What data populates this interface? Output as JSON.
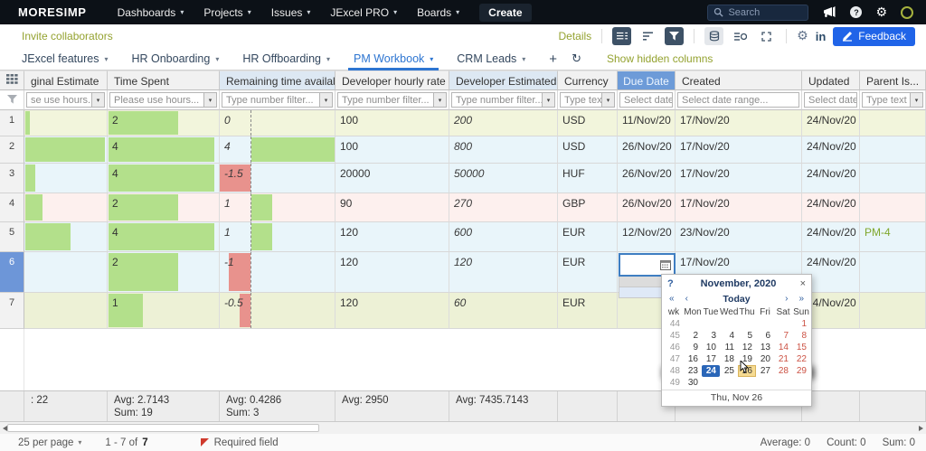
{
  "navbar": {
    "logo": "MORESIMP",
    "menus": [
      "Dashboards",
      "Projects",
      "Issues",
      "JExcel PRO",
      "Boards"
    ],
    "create_label": "Create",
    "search_placeholder": "Search"
  },
  "toolbar": {
    "invite_label": "Invite collaborators",
    "details_label": "Details",
    "linkedin_label": "in",
    "feedback_label": "Feedback",
    "feedback_color": "#2064e8",
    "active_button_color": "#3d5166"
  },
  "tabs": {
    "items": [
      {
        "label": "JExcel features",
        "active": false
      },
      {
        "label": "HR Onboarding",
        "active": false
      },
      {
        "label": "HR Offboarding",
        "active": false
      },
      {
        "label": "PM Workbook",
        "active": true
      },
      {
        "label": "CRM Leads",
        "active": false
      }
    ],
    "active_color": "#2d75d1",
    "show_hidden_label": "Show hidden columns"
  },
  "grid": {
    "columns": [
      {
        "key": "corner",
        "label": "",
        "width": 27,
        "ftype": "corner"
      },
      {
        "key": "oe",
        "label": "ginal Estimate",
        "width": 92,
        "hl": false,
        "selected": false,
        "filter": "se use hours...",
        "ftype": "select"
      },
      {
        "key": "ts",
        "label": "Time Spent",
        "width": 124,
        "hl": false,
        "selected": false,
        "filter": "Please use hours...",
        "ftype": "select"
      },
      {
        "key": "rta",
        "label": "Remaining time available",
        "width": 128,
        "hl": true,
        "selected": false,
        "filter": "Type number filter...",
        "ftype": "select"
      },
      {
        "key": "dhr",
        "label": "Developer hourly rate",
        "width": 126,
        "hl": false,
        "selected": false,
        "filter": "Type number filter...",
        "ftype": "select"
      },
      {
        "key": "de",
        "label": "Developer Estimated ...",
        "width": 120,
        "hl": true,
        "selected": false,
        "filter": "Type number filter...",
        "ftype": "select"
      },
      {
        "key": "cur",
        "label": "Currency",
        "width": 66,
        "hl": false,
        "selected": false,
        "filter": "Type text f",
        "ftype": "select"
      },
      {
        "key": "due",
        "label": "Due Date",
        "width": 64,
        "hl": false,
        "selected": true,
        "filter": "Select date",
        "ftype": "date"
      },
      {
        "key": "created",
        "label": "Created",
        "width": 140,
        "hl": false,
        "selected": false,
        "filter": "Select date range...",
        "ftype": "date"
      },
      {
        "key": "updated",
        "label": "Updated",
        "width": 64,
        "hl": false,
        "selected": false,
        "filter": "Select date",
        "ftype": "date"
      },
      {
        "key": "parent",
        "label": "Parent Is...",
        "width": 73,
        "hl": false,
        "selected": false,
        "filter": "Type text f",
        "ftype": "select"
      }
    ],
    "rows": [
      {
        "num": "1",
        "h": 29,
        "bg": "#f2f5dc",
        "sel": false,
        "editing": false,
        "oe_bar": 5,
        "ts": "2",
        "ts_bar": 77,
        "rta": "0",
        "rta_bar": 0,
        "dhr": "100",
        "de": "200",
        "cur": "USD",
        "due": "11/Nov/20",
        "created": "17/Nov/20",
        "updated": "24/Nov/20",
        "parent": ""
      },
      {
        "num": "2",
        "h": 30,
        "bg": "#e9f5fa",
        "sel": false,
        "editing": false,
        "oe_bar": 88,
        "ts": "4",
        "ts_bar": 117,
        "rta": "4",
        "rta_bar": 96,
        "dhr": "100",
        "de": "800",
        "cur": "USD",
        "due": "26/Nov/20",
        "created": "17/Nov/20",
        "updated": "24/Nov/20",
        "parent": ""
      },
      {
        "num": "3",
        "h": 33,
        "bg": "#e9f5fa",
        "sel": false,
        "editing": false,
        "oe_bar": 11,
        "ts": "4",
        "ts_bar": 117,
        "rta": "-1.5",
        "rta_bar": -34,
        "dhr": "20000",
        "de": "50000",
        "cur": "HUF",
        "due": "26/Nov/20",
        "created": "17/Nov/20",
        "updated": "24/Nov/20",
        "parent": ""
      },
      {
        "num": "4",
        "h": 32,
        "bg": "#fdf0ee",
        "sel": false,
        "editing": false,
        "oe_bar": 19,
        "ts": "2",
        "ts_bar": 77,
        "rta": "1",
        "rta_bar": 23,
        "dhr": "90",
        "de": "270",
        "cur": "GBP",
        "due": "26/Nov/20",
        "created": "17/Nov/20",
        "updated": "24/Nov/20",
        "parent": ""
      },
      {
        "num": "5",
        "h": 33,
        "bg": "#e9f5fa",
        "sel": false,
        "editing": false,
        "oe_bar": 50,
        "ts": "4",
        "ts_bar": 117,
        "rta": "1",
        "rta_bar": 23,
        "dhr": "120",
        "de": "600",
        "cur": "EUR",
        "due": "12/Nov/20",
        "created": "23/Nov/20",
        "updated": "24/Nov/20",
        "parent": "PM-4"
      },
      {
        "num": "6",
        "h": 45,
        "bg": "#e9f5fa",
        "sel": true,
        "editing": true,
        "oe_bar": 0,
        "ts": "2",
        "ts_bar": 77,
        "rta": "-1",
        "rta_bar": -24,
        "dhr": "120",
        "de": "120",
        "cur": "EUR",
        "due": "",
        "created": "17/Nov/20",
        "updated": "24/Nov/20",
        "parent": ""
      },
      {
        "num": "7",
        "h": 40,
        "bg": "#edf1d6",
        "sel": false,
        "editing": false,
        "oe_bar": 0,
        "ts": "1",
        "ts_bar": 38,
        "rta": "-0.5",
        "rta_bar": -12,
        "dhr": "120",
        "de": "60",
        "cur": "EUR",
        "due": "",
        "created": "",
        "updated": "24/Nov/20",
        "parent": ""
      }
    ],
    "bar_positive_color": "#b3e08b",
    "bar_negative_color": "#e8928d",
    "summary": {
      "oe": [
        ": 22"
      ],
      "ts": [
        "Avg: 2.7143",
        "Sum: 19"
      ],
      "rta": [
        "Avg: 0.4286",
        "Sum: 3"
      ],
      "dhr": [
        "Avg: 2950"
      ],
      "de": [
        "Avg: 7435.7143"
      ]
    }
  },
  "calendar": {
    "help": "?",
    "title": "November, 2020",
    "close": "×",
    "nav": [
      "«",
      "‹",
      "Today",
      "›",
      "»"
    ],
    "day_headers": [
      "wk",
      "Mon",
      "Tue",
      "Wed",
      "Thu",
      "Fri",
      "Sat",
      "Sun"
    ],
    "weeks": [
      {
        "wk": "44",
        "days": [
          "",
          "",
          "",
          "",
          "",
          "",
          "1"
        ]
      },
      {
        "wk": "45",
        "days": [
          "2",
          "3",
          "4",
          "5",
          "6",
          "7",
          "8"
        ]
      },
      {
        "wk": "46",
        "days": [
          "9",
          "10",
          "11",
          "12",
          "13",
          "14",
          "15"
        ]
      },
      {
        "wk": "47",
        "days": [
          "16",
          "17",
          "18",
          "19",
          "20",
          "21",
          "22"
        ]
      },
      {
        "wk": "48",
        "days": [
          "23",
          "24",
          "25",
          "26",
          "27",
          "28",
          "29"
        ]
      },
      {
        "wk": "49",
        "days": [
          "30",
          "",
          "",
          "",
          "",
          "",
          ""
        ]
      }
    ],
    "selected_day": "24",
    "selected_week": "48",
    "hover_day": "26",
    "hover_week": "48",
    "selected_color": "#2a66b8",
    "weekend_color": "#cc5244",
    "footer": "Thu, Nov 26"
  },
  "footer": {
    "per_page": "25 per page",
    "range_prefix": "1 - 7 of",
    "range_total": "7",
    "required_label": "Required field",
    "stats": [
      "Average: 0",
      "Count: 0",
      "Sum: 0"
    ]
  }
}
